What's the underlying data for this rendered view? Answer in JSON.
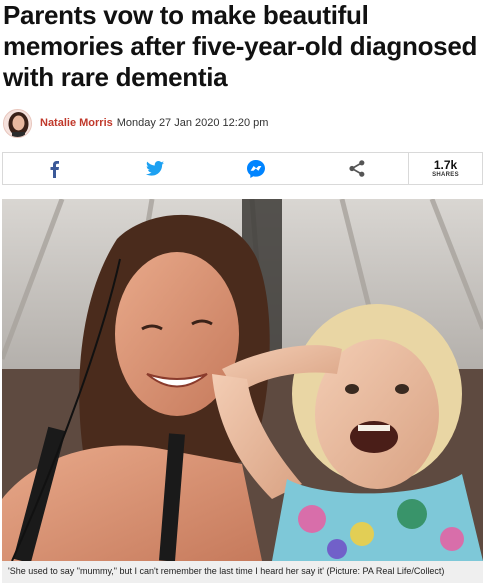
{
  "article": {
    "headline": "Parents vow to make beautiful memories after five-year-old diagnosed with rare dementia",
    "author": "Natalie Morris",
    "date": "Monday 27 Jan 2020 12:20 pm"
  },
  "share": {
    "buttons": [
      {
        "icon": "facebook-icon",
        "color": "#3b5998"
      },
      {
        "icon": "twitter-icon",
        "color": "#1da1f2"
      },
      {
        "icon": "messenger-icon",
        "color": "#0084ff"
      },
      {
        "icon": "share-icon",
        "color": "#555555"
      }
    ],
    "count": "1.7k",
    "count_label": "SHARES"
  },
  "photo": {
    "caption": "'She used to say \"mummy,\" but I can't remember the last time I heard her say it' (Picture: PA Real Life/Collect)"
  }
}
